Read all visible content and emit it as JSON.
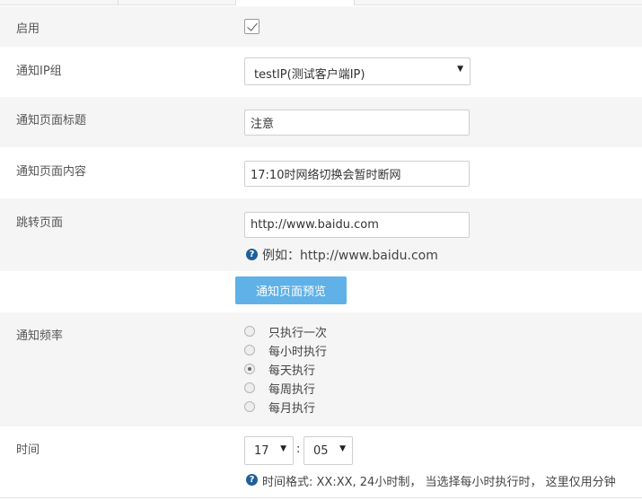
{
  "form": {
    "enable": {
      "label": "启用",
      "checked": true
    },
    "ip_group": {
      "label": "通知IP组",
      "value": "testIP(测试客户端IP)"
    },
    "page_title": {
      "label": "通知页面标题",
      "value": "注意"
    },
    "page_content": {
      "label": "通知页面内容",
      "value": "17:10时网络切换会暂时断网"
    },
    "redirect": {
      "label": "跳转页面",
      "value": "http://www.baidu.com",
      "help": "例如：http://www.baidu.com"
    },
    "preview_button": "通知页面预览",
    "frequency": {
      "label": "通知频率",
      "options": [
        "只执行一次",
        "每小时执行",
        "每天执行",
        "每周执行",
        "每月执行"
      ],
      "selected": "每天执行"
    },
    "time": {
      "label": "时间",
      "hour": "17",
      "minute": "05",
      "separator": ":",
      "help": "时间格式: XX:XX, 24小时制， 当选择每小时执行时， 这里仅用分钟"
    }
  },
  "icons": {
    "checkbox": "check-icon",
    "dropdown": "caret-down-icon",
    "help": "question-circle-icon"
  },
  "colors": {
    "row_alt_background": "#f5f5f5",
    "preview_button": "#5fb1e8",
    "help_icon": "#1f5f9a"
  }
}
